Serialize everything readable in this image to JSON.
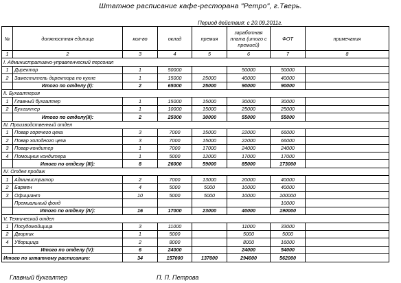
{
  "title": "Штатное расписание  кафе-ресторана \"Ретро\", г.Тверь.",
  "period": "Период  действия:  с 20.09.2011г.",
  "headers": {
    "no": "№",
    "position": "должностная единица",
    "qty": "кол-во",
    "salary": "оклад",
    "bonus": "премия",
    "wage": "заработная плата (итого с премией)",
    "fot": "ФОТ",
    "notes": "примечания"
  },
  "col_numbers": [
    "1",
    "2",
    "3",
    "4",
    "5",
    "6",
    "7",
    "8"
  ],
  "sections": [
    {
      "title": "I. Административно-управленческий персонал",
      "rows": [
        {
          "n": "1",
          "name": "Директор",
          "qty": "1",
          "salary": "50000",
          "bonus": "",
          "wage": "50000",
          "fot": "50000"
        },
        {
          "n": "2",
          "name": "Заместитель директора по кухне",
          "qty": "1",
          "salary": "15000",
          "bonus": "25000",
          "wage": "40000",
          "fot": "40000"
        }
      ],
      "total": {
        "label": "Итого по отделу (I):",
        "qty": "2",
        "salary": "65000",
        "bonus": "25000",
        "wage": "90000",
        "fot": "90000"
      }
    },
    {
      "title": "II. Бухгалтерия",
      "rows": [
        {
          "n": "1",
          "name": "Главный бухгалтер",
          "qty": "1",
          "salary": "15000",
          "bonus": "15000",
          "wage": "30000",
          "fot": "30000"
        },
        {
          "n": "2",
          "name": "Бухгалтер",
          "qty": "1",
          "salary": "10000",
          "bonus": "15000",
          "wage": "25000",
          "fot": "25000"
        }
      ],
      "total": {
        "label": "Итого по отделу(II):",
        "qty": "2",
        "salary": "25000",
        "bonus": "30000",
        "wage": "55000",
        "fot": "55000"
      }
    },
    {
      "title": "III. Производственный отдел",
      "rows": [
        {
          "n": "1",
          "name": "Повар горячего цеха",
          "qty": "3",
          "salary": "7000",
          "bonus": "15000",
          "wage": "22000",
          "fot": "66000"
        },
        {
          "n": "2",
          "name": "Повар холодного цеха",
          "qty": "3",
          "salary": "7000",
          "bonus": "15000",
          "wage": "22000",
          "fot": "66000"
        },
        {
          "n": "3",
          "name": "Повар-кондитер",
          "qty": "1",
          "salary": "7000",
          "bonus": "17000",
          "wage": "24000",
          "fot": "24000"
        },
        {
          "n": "4",
          "name": "Помощник кондитера",
          "qty": "1",
          "salary": "5000",
          "bonus": "12000",
          "wage": "17000",
          "fot": "17000"
        }
      ],
      "total": {
        "label": "Итого по отделу (III):",
        "qty": "8",
        "salary": "26000",
        "bonus": "59000",
        "wage": "85000",
        "fot": "173000"
      }
    },
    {
      "title": "IV. Отдел продаж",
      "rows": [
        {
          "n": "1",
          "name": "Администратор",
          "qty": "2",
          "salary": "7000",
          "bonus": "13000",
          "wage": "20000",
          "fot": "40000"
        },
        {
          "n": "2",
          "name": "Бармен",
          "qty": "4",
          "salary": "5000",
          "bonus": "5000",
          "wage": "10000",
          "fot": "40000"
        },
        {
          "n": "3",
          "name": "Официант",
          "qty": "10",
          "salary": "5000",
          "bonus": "5000",
          "wage": "10000",
          "fot": "100000"
        },
        {
          "n": "",
          "name": "Премиальный фонд",
          "qty": "",
          "salary": "",
          "bonus": "",
          "wage": "",
          "fot": "10000"
        }
      ],
      "total": {
        "label": "Итого по отделу (IV):",
        "qty": "16",
        "salary": "17000",
        "bonus": "23000",
        "wage": "40000",
        "fot": "190000"
      }
    },
    {
      "title": "V. Технический отдел",
      "rows": [
        {
          "n": "1",
          "name": "Посудомойщица",
          "qty": "3",
          "salary": "11000",
          "bonus": "",
          "wage": "11000",
          "fot": "33000"
        },
        {
          "n": "2",
          "name": "Дворник",
          "qty": "1",
          "salary": "5000",
          "bonus": "",
          "wage": "5000",
          "fot": "5000"
        },
        {
          "n": "4",
          "name": "Уборщица",
          "qty": "2",
          "salary": "8000",
          "bonus": "",
          "wage": "8000",
          "fot": "16000"
        }
      ],
      "total": {
        "label": "Итого по отделу (V):",
        "qty": "6",
        "salary": "24000",
        "bonus": "",
        "wage": "24000",
        "fot": "54000"
      }
    }
  ],
  "grand_total": {
    "label": "Итого по штатному расписанию:",
    "qty": "34",
    "salary": "157000",
    "bonus": "137000",
    "wage": "294000",
    "fot": "562000"
  },
  "footer": {
    "role": "Главный бухгалтер",
    "name": "П. П. Петрова"
  }
}
